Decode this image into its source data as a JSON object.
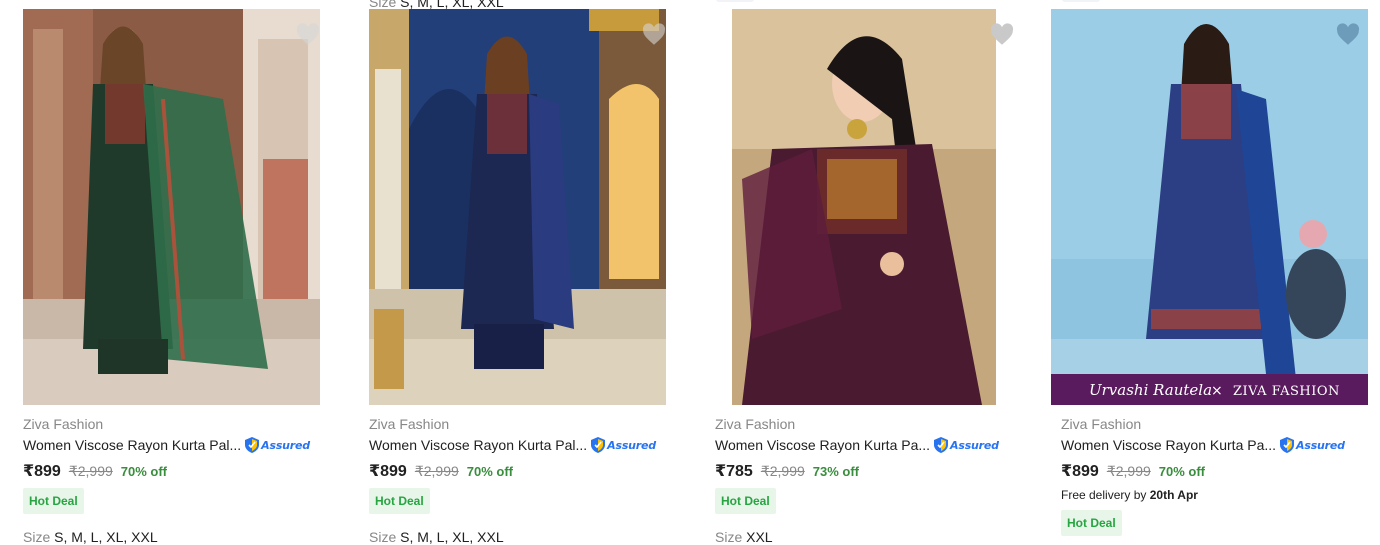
{
  "top_clipped": {
    "size_label": "Size",
    "size_value": "S, M, L, XL, XXL"
  },
  "products": [
    {
      "brand": "Ziva Fashion",
      "title": "Women Viscose Rayon Kurta Pal...",
      "assured": "Assured",
      "price": "₹899",
      "mrp": "₹2,999",
      "discount": "70% off",
      "deal": "Hot Deal",
      "size_label": "Size",
      "sizes": "S, M, L, XL, XXL",
      "image_icon": "kurta-green-image"
    },
    {
      "brand": "Ziva Fashion",
      "title": "Women Viscose Rayon Kurta Pal...",
      "assured": "Assured",
      "price": "₹899",
      "mrp": "₹2,999",
      "discount": "70% off",
      "deal": "Hot Deal",
      "size_label": "Size",
      "sizes": "S, M, L, XL, XXL",
      "image_icon": "kurta-navy-image"
    },
    {
      "brand": "Ziva Fashion",
      "title": "Women Viscose Rayon Kurta Pa...",
      "assured": "Assured",
      "price": "₹785",
      "mrp": "₹2,999",
      "discount": "73% off",
      "deal": "Hot Deal",
      "size_label": "Size",
      "sizes": "XXL",
      "image_icon": "kurta-wine-image"
    },
    {
      "brand": "Ziva Fashion",
      "title": "Women Viscose Rayon Kurta Pa...",
      "assured": "Assured",
      "price": "₹899",
      "mrp": "₹2,999",
      "discount": "70% off",
      "delivery_prefix": "Free delivery by",
      "delivery_date": "20th Apr",
      "deal": "Hot Deal",
      "banner_left": "Urvashi Rautela",
      "banner_x": "×",
      "banner_right": "ZIVA FASHION",
      "image_icon": "kurta-blue-image"
    }
  ],
  "colors": {
    "accent": "#2874f0",
    "discount": "#388e3c",
    "deal_bg": "#e8f5e9",
    "deal_text": "#26a541",
    "muted": "#878787"
  }
}
